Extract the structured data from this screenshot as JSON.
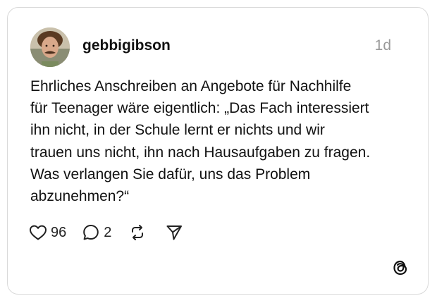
{
  "post": {
    "username": "gebbigibson",
    "timestamp": "1d",
    "text_lines": [
      "Ehrliches Anschreiben an Angebote für Nachhilfe",
      "für Teenager wäre eigentlich: „Das Fach interessiert",
      "ihn nicht, in der Schule lernt er nichts und wir",
      "trauen uns nicht, ihn nach Hausaufgaben zu fragen.",
      "Was verlangen Sie dafür, uns das Problem",
      "abzunehmen?“"
    ]
  },
  "actions": {
    "likes": "96",
    "replies": "2",
    "like_icon": "heart-icon",
    "reply_icon": "speech-bubble-icon",
    "repost_icon": "repost-icon",
    "share_icon": "send-icon"
  },
  "brand": {
    "logo": "threads-logo-icon"
  },
  "colors": {
    "text": "#111111",
    "muted": "#9a9a9a",
    "border": "#d9d9d9",
    "background": "#ffffff"
  }
}
